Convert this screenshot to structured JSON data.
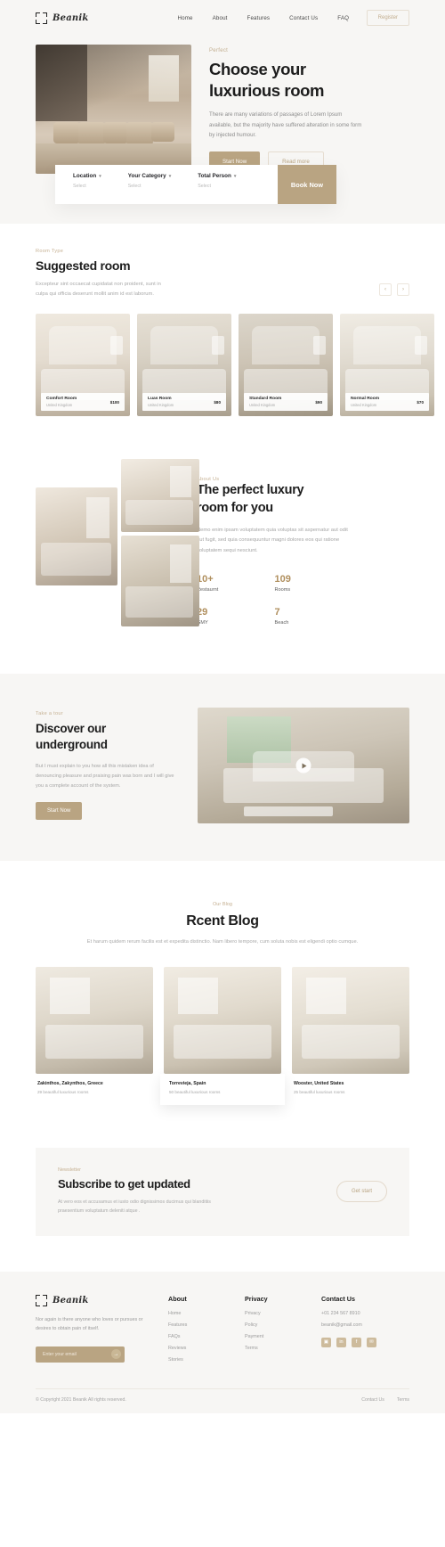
{
  "nav": {
    "brand": "Beanik",
    "links": [
      "Home",
      "About",
      "Features",
      "Contact Us",
      "FAQ"
    ],
    "register": "Register"
  },
  "hero": {
    "eyebrow": "Perfect",
    "title_line1": "Choose your",
    "title_line2": "luxurious room",
    "description": "There are many variations of passages of Lorem Ipsum available, but the majority have suffered alteration in some form by injected humour.",
    "primary_button": "Start Now",
    "secondary_button": "Read more"
  },
  "bookbar": {
    "fields": [
      {
        "label": "Location",
        "value": "Select"
      },
      {
        "label": "Your Category",
        "value": "Select"
      },
      {
        "label": "Total Person",
        "value": "Select"
      }
    ],
    "button": "Book Now"
  },
  "suggested": {
    "eyebrow": "Room Type",
    "title": "Suggested room",
    "description": "Excepteur sint occaecat cupidatat non proident, sunt in culpa qui officia deserunt mollit anim id est laborum.",
    "prev": "‹",
    "next": "›",
    "rooms": [
      {
        "name": "Comfort Room",
        "location": "United Kingdom",
        "price": "$100"
      },
      {
        "name": "Luas Room",
        "location": "United Kingdom",
        "price": "$80"
      },
      {
        "name": "Standard Room",
        "location": "United Kingdom",
        "price": "$90"
      },
      {
        "name": "Normal Room",
        "location": "United Kingdom",
        "price": "$70"
      }
    ]
  },
  "about": {
    "eyebrow": "About Us",
    "title_line1": "The perfect luxury",
    "title_line2": "room for you",
    "description": "Nemo enim ipsam voluptatem quia voluptas sit aspernatur aut odit aut fugit, sed quia consequuntur magni dolores eos qui ratione voluptatem sequi nesciunt.",
    "stats": [
      {
        "number": "10+",
        "label": "Restaurnt"
      },
      {
        "number": "109",
        "label": "Rooms"
      },
      {
        "number": "29",
        "label": "GMY"
      },
      {
        "number": "7",
        "label": "Beach"
      }
    ]
  },
  "discover": {
    "eyebrow": "Take a tour",
    "title_line1": "Discover our",
    "title_line2": "underground",
    "description": "But I must explain to you how all this mistaken idea of denouncing pleasure and praising pain was born and I will give you a complete account of the system.",
    "button": "Start Now",
    "play": "play-button"
  },
  "blog": {
    "eyebrow": "Our Blog",
    "title": "Rcent Blog",
    "description": "Et harum quidem rerum facilis est et expedita distinctio. Nam libero tempore, cum soluta nobis est eligendi optio cumque.",
    "posts": [
      {
        "title": "Zakinthos, Zakynthos, Greece",
        "subtitle": "29 beautiful luxurious rooms"
      },
      {
        "title": "Torrevieja, Spain",
        "subtitle": "50 beautiful luxurious rooms"
      },
      {
        "title": "Wooster, United States",
        "subtitle": "25 beautiful luxurious rooms"
      }
    ]
  },
  "newsletter": {
    "eyebrow": "Newsletter",
    "title": "Subscribe to get updated",
    "description": "At vero eos et accusamus et iusto odio dignissimos ducimus qui blanditiis praesentium voluptatum deleniti atque .",
    "button": "Get start"
  },
  "footer": {
    "brand": "Beanik",
    "about": "Nor again is there anyone who loves or pursues or desires to obtain pain of itself.",
    "email_placeholder": "Enter your email",
    "submit_icon": "→",
    "columns": [
      {
        "heading": "About",
        "items": [
          "Home",
          "Features",
          "FAQs",
          "Reviews",
          "Stories"
        ]
      },
      {
        "heading": "Privacy",
        "items": [
          "Privacy",
          "Policy",
          "Payment",
          "Terms"
        ]
      }
    ],
    "contact": {
      "heading": "Contact Us",
      "phone": "+01 234 567 8910",
      "email": "beanik@gmail.com",
      "socials": [
        "instagram-icon",
        "linkedin-icon",
        "facebook-icon",
        "twitter-icon"
      ],
      "social_glyphs": [
        "▣",
        "in",
        "f",
        "✉"
      ]
    },
    "copyright": "© Copyright 2021 Beanik All rights reserved.",
    "bottom_links": [
      "Contact Us",
      "Terms"
    ]
  },
  "colors": {
    "accent": "#b9a482",
    "eyebrow": "#c6b193",
    "stat": "#b08f5e",
    "surface": "#f7f6f4"
  }
}
